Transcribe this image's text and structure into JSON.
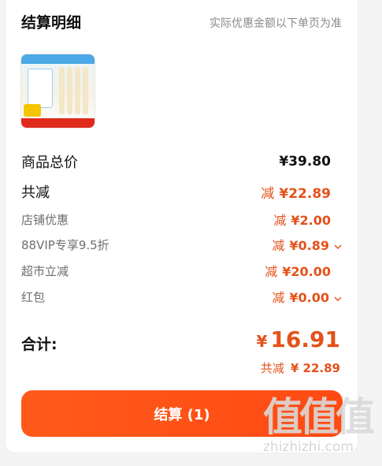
{
  "header": {
    "title": "结算明细",
    "note": "实际优惠金额以下单页为准"
  },
  "product": {
    "image_icon": "noodle-product-icon"
  },
  "summary": {
    "subtotal_label": "商品总价",
    "subtotal_value": "¥39.80",
    "discount_label": "共减",
    "discount_prefix": "减",
    "discount_value": "¥22.89"
  },
  "discounts": [
    {
      "label": "店铺优惠",
      "prefix": "减",
      "value": "¥2.00",
      "expandable": false
    },
    {
      "label": "88VIP专享9.5折",
      "prefix": "减",
      "value": "¥0.89",
      "expandable": true
    },
    {
      "label": "超市立减",
      "prefix": "减",
      "value": "¥20.00",
      "expandable": false
    },
    {
      "label": "红包",
      "prefix": "减",
      "value": "¥0.00",
      "expandable": true
    }
  ],
  "total": {
    "label": "合计:",
    "currency": "¥",
    "amount": "16.91",
    "saved_prefix": "共减",
    "saved_value": "¥ 22.89"
  },
  "checkout": {
    "label": "结算 (1)"
  },
  "watermark": {
    "big": "值值值",
    "small": "zhizhizhi.com"
  },
  "colors": {
    "accent": "#e4521a",
    "button": "#ff5a1a"
  }
}
